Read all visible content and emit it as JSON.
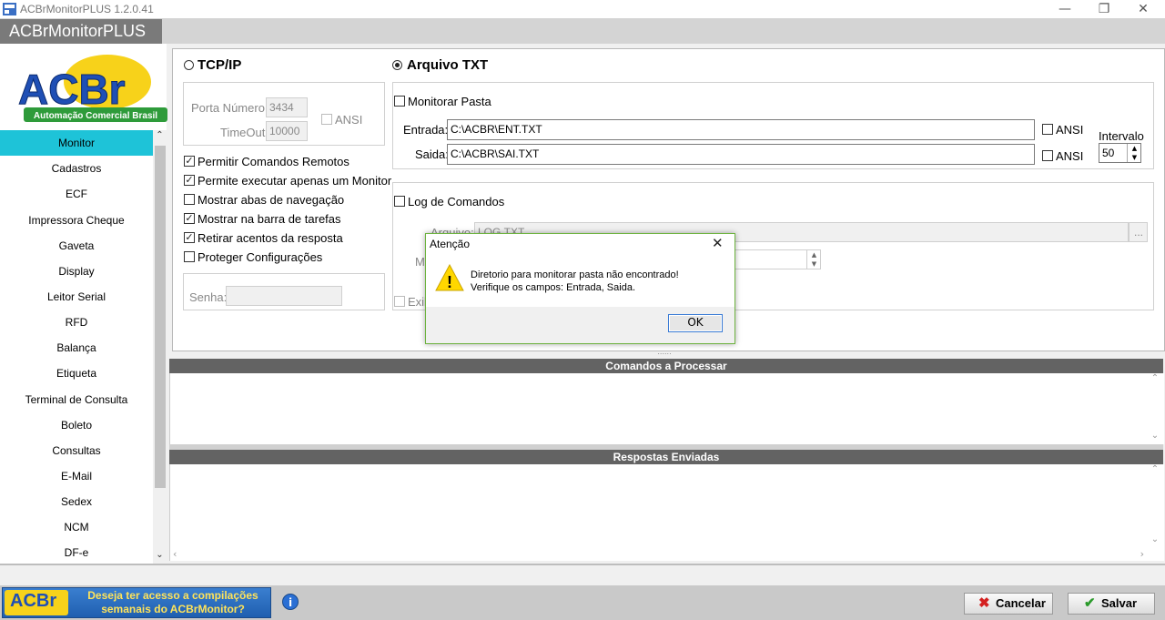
{
  "window": {
    "title": "ACBrMonitorPLUS 1.2.0.41",
    "minimize_glyph": "—",
    "restore_glyph": "❐",
    "close_glyph": "✕"
  },
  "app": {
    "name": "ACBrMonitorPLUS",
    "logo_text": "ACBr",
    "logo_subtitle": "Automação Comercial Brasil",
    "accent_color": "#1ec3d8"
  },
  "sidebar": {
    "items": [
      {
        "label": "Monitor",
        "active": true
      },
      {
        "label": "Cadastros"
      },
      {
        "label": "ECF"
      },
      {
        "label": "Impressora Cheque"
      },
      {
        "label": "Gaveta"
      },
      {
        "label": "Display"
      },
      {
        "label": "Leitor Serial"
      },
      {
        "label": "RFD"
      },
      {
        "label": "Balança"
      },
      {
        "label": "Etiqueta"
      },
      {
        "label": "Terminal de Consulta"
      },
      {
        "label": "Boleto"
      },
      {
        "label": "Consultas"
      },
      {
        "label": "E-Mail"
      },
      {
        "label": "Sedex"
      },
      {
        "label": "NCM"
      },
      {
        "label": "DF-e"
      }
    ],
    "scroll_up_glyph": "⌃",
    "scroll_down_glyph": "⌄"
  },
  "monitor": {
    "tcp": {
      "label": "TCP/IP",
      "selected": false,
      "port_label": "Porta Número:",
      "port_value": "3434",
      "timeout_label": "TimeOut:",
      "timeout_value": "10000",
      "ansi_label": "ANSI"
    },
    "options": [
      {
        "label": "Permitir Comandos Remotos",
        "checked": true
      },
      {
        "label": "Permite executar apenas um Monitor",
        "checked": true
      },
      {
        "label": "Mostrar abas de navegação",
        "checked": false
      },
      {
        "label": "Mostrar na barra de tarefas",
        "checked": true
      },
      {
        "label": "Retirar acentos da resposta",
        "checked": true
      },
      {
        "label": "Proteger Configurações",
        "checked": false
      }
    ],
    "password_label": "Senha:",
    "txt": {
      "label": "Arquivo TXT",
      "selected": true,
      "monitor_folder_label": "Monitorar Pasta",
      "entrada_label": "Entrada:",
      "entrada_value": "C:\\ACBR\\ENT.TXT",
      "saida_label": "Saida:",
      "saida_value": "C:\\ACBR\\SAI.TXT",
      "ansi_label": "ANSI",
      "interval_label": "Intervalo",
      "interval_value": "50"
    },
    "log": {
      "label": "Log de Comandos",
      "file_label": "Arquivo:",
      "file_value": "LOG.TXT",
      "browse_label": "...",
      "max_label": "M",
      "show_label": "Exib"
    }
  },
  "lists": {
    "commands_header": "Comandos a Processar",
    "responses_header": "Respostas Enviadas",
    "splitter_glyph": "......"
  },
  "dialog": {
    "title": "Atenção",
    "message_line1": "Diretorio para monitorar pasta não encontrado!",
    "message_line2": "Verifique os campos: Entrada, Saida.",
    "ok_label": "OK",
    "warning_glyph": "!"
  },
  "footer": {
    "banner_logo": "ACBr",
    "banner_line1": "Deseja ter acesso a compilações",
    "banner_line2": "semanais do ACBrMonitor?",
    "info_glyph": "i",
    "cancel_label": "Cancelar",
    "save_label": "Salvar"
  }
}
